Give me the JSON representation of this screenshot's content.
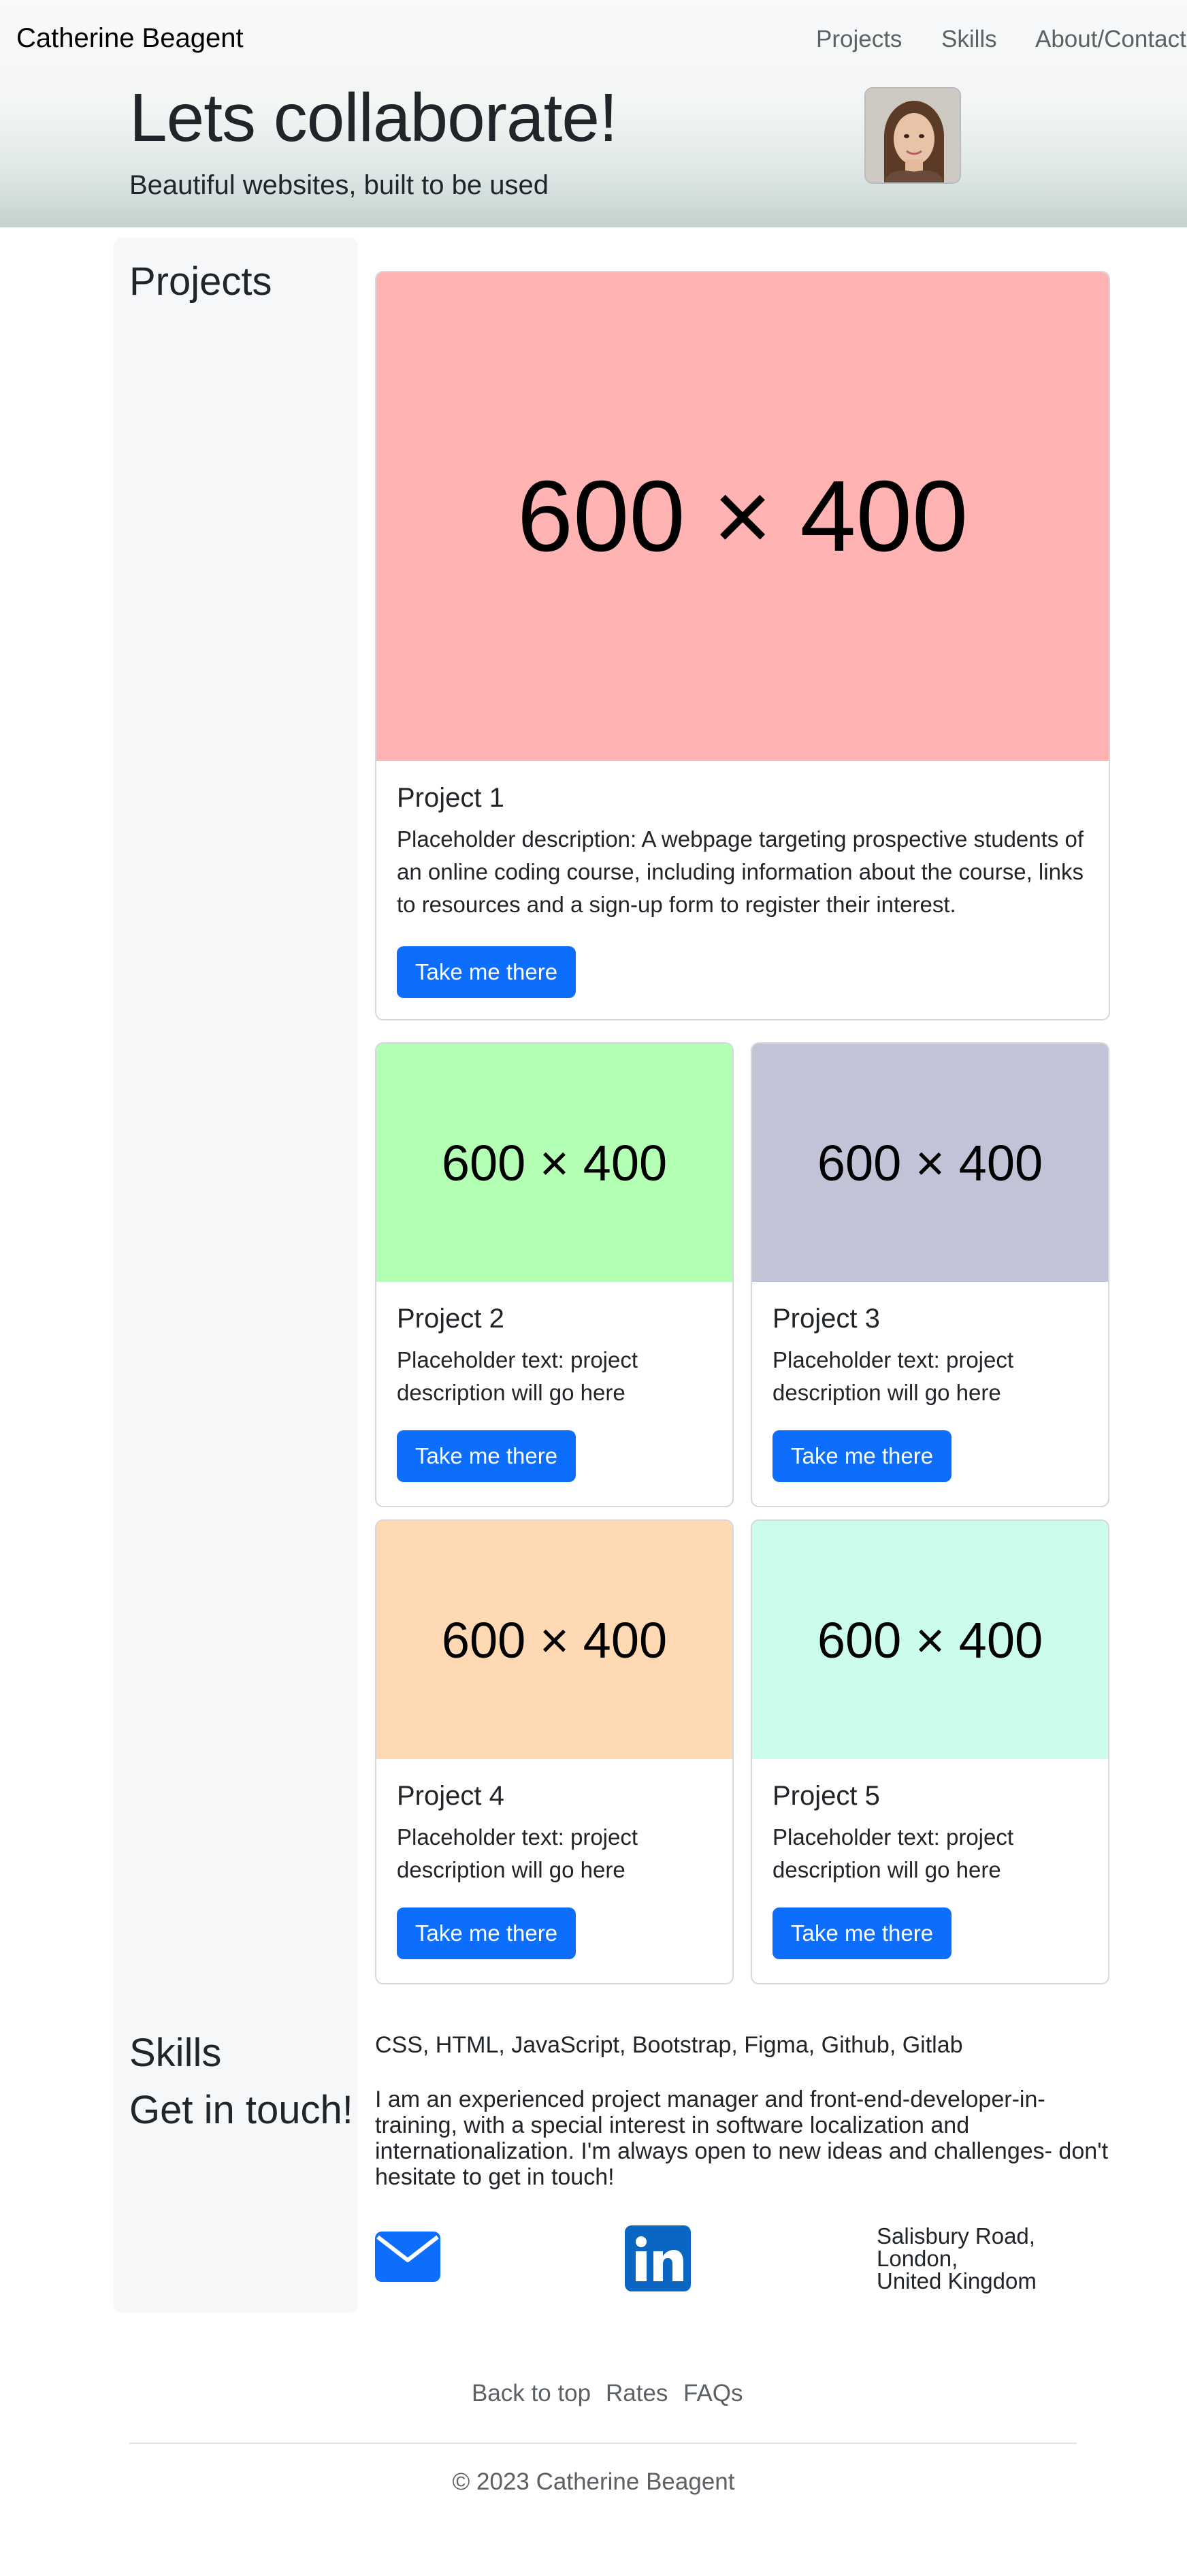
{
  "header": {
    "brand": "Catherine Beagent",
    "nav": [
      "Projects",
      "Skills",
      "About/Contact"
    ],
    "hero_title": "Lets collaborate!",
    "hero_subtitle": "Beautiful websites, built to be used"
  },
  "sidebar": {
    "projects_heading": "Projects",
    "skills_heading": "Skills",
    "contact_heading": "Get in touch!"
  },
  "projects": [
    {
      "placeholder": "600 × 400",
      "title": "Project 1",
      "description": "Placeholder description: A webpage targeting prospective students of an online coding course, including information about the course, links to resources and a sign-up form to register their interest.",
      "button": "Take me there",
      "color": "#ffb3b3"
    },
    {
      "placeholder": "600 × 400",
      "title": "Project 2",
      "description": "Placeholder text: project description will go here",
      "button": "Take me there",
      "color": "#b3ffb3"
    },
    {
      "placeholder": "600 × 400",
      "title": "Project 3",
      "description": "Placeholder text: project description will go here",
      "button": "Take me there",
      "color": "#c2c3d6"
    },
    {
      "placeholder": "600 × 400",
      "title": "Project 4",
      "description": "Placeholder text: project description will go here",
      "button": "Take me there",
      "color": "#ffd9b3"
    },
    {
      "placeholder": "600 × 400",
      "title": "Project 5",
      "description": "Placeholder text: project description will go here",
      "button": "Take me there",
      "color": "#ccfcec"
    }
  ],
  "skills": {
    "list": "CSS, HTML, JavaScript, Bootstrap, Figma, Github, Gitlab"
  },
  "contact": {
    "about": "I am an experienced project manager and front-end-developer-in-training, with a special interest in software localization and internationalization. I'm always open to new ideas and challenges- don't hesitate to get in touch!",
    "mail_icon": "envelope-icon",
    "linkedin_icon": "linkedin-icon",
    "address": [
      "Salisbury Road,",
      "London,",
      "United Kingdom"
    ]
  },
  "footer": {
    "links": [
      "Back to top",
      "Rates",
      "FAQs"
    ],
    "copyright": "© 2023 Catherine Beagent"
  },
  "colors": {
    "primary": "#0d6efd",
    "linkedin": "#0a66c2",
    "sidebar_bg": "#f6f7f9"
  }
}
